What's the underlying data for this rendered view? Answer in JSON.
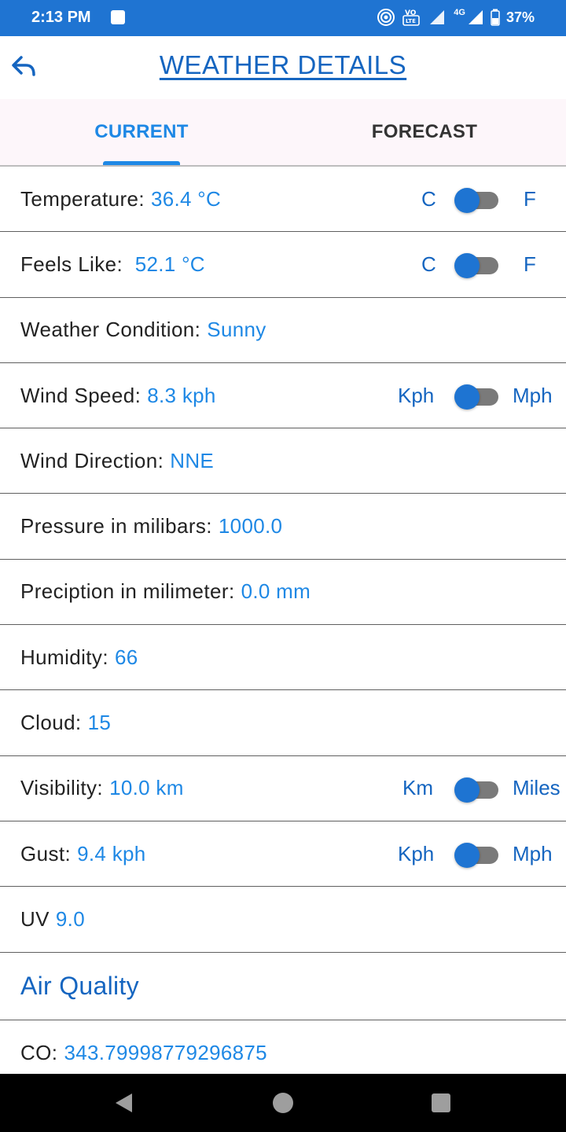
{
  "status_bar": {
    "time": "2:13 PM",
    "network_label": "4G",
    "battery": "37%"
  },
  "header": {
    "title": "WEATHER DETAILS",
    "back_icon": "back-arrow-icon"
  },
  "tabs": [
    {
      "label": "CURRENT",
      "active": true
    },
    {
      "label": "FORECAST",
      "active": false
    }
  ],
  "rows": {
    "temperature": {
      "label": "Temperature:",
      "value": "36.4 °C",
      "unit_left": "C",
      "unit_right": "F"
    },
    "feels_like": {
      "label": "Feels Like: ",
      "value": "52.1 °C",
      "unit_left": "C",
      "unit_right": "F"
    },
    "condition": {
      "label": "Weather Condition:",
      "value": "Sunny"
    },
    "wind_speed": {
      "label": "Wind Speed:",
      "value": "8.3 kph",
      "unit_left": "Kph",
      "unit_right": "Mph"
    },
    "wind_direction": {
      "label": "Wind Direction:",
      "value": "NNE"
    },
    "pressure": {
      "label": "Pressure in milibars:",
      "value": "1000.0"
    },
    "precipitation": {
      "label": "Preciption in milimeter:",
      "value": "0.0 mm"
    },
    "humidity": {
      "label": "Humidity:",
      "value": "66"
    },
    "cloud": {
      "label": "Cloud:",
      "value": "15"
    },
    "visibility": {
      "label": "Visibility:",
      "value": "10.0 km",
      "unit_left": "Km",
      "unit_right": "Miles"
    },
    "gust": {
      "label": "Gust:",
      "value": "9.4 kph",
      "unit_left": "Kph",
      "unit_right": "Mph"
    },
    "uv": {
      "label": "UV",
      "value": "9.0"
    }
  },
  "air_quality": {
    "title": "Air Quality",
    "co": {
      "label": "CO:",
      "value": "343.79998779296875"
    }
  },
  "colors": {
    "primary": "#1f74d2",
    "accent": "#1e88e5",
    "title_blue": "#1565c0"
  }
}
